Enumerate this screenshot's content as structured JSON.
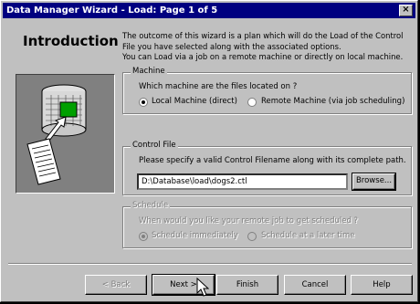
{
  "window": {
    "title": "Data Manager Wizard - Load: Page 1 of 5",
    "close_glyph": "×"
  },
  "page": {
    "heading": "Introduction",
    "intro_line1": "The outcome of this wizard is a plan which will do the Load of the Control",
    "intro_line2": "File you have selected along with the associated options.",
    "intro_line3": "You can Load via a job on a remote machine or directly on local machine."
  },
  "machine": {
    "group_label": "Machine",
    "question": "Which machine are the files located on ?",
    "options": [
      {
        "label": "Local Machine (direct)",
        "checked": true
      },
      {
        "label": "Remote Machine (via job scheduling)",
        "checked": false
      }
    ]
  },
  "control_file": {
    "group_label": "Control File",
    "prompt": "Please specify a valid Control Filename along with its complete path.",
    "value": "D:\\Database\\load\\dogs2.ctl",
    "browse_label": "Browse..."
  },
  "schedule": {
    "group_label": "Schedule",
    "question": "When would you like your remote job to get scheduled ?",
    "options": [
      {
        "label": "Schedule immediately",
        "checked": true
      },
      {
        "label": "Schedule at a later time",
        "checked": false
      }
    ]
  },
  "buttons": {
    "back": "< Back",
    "next": "Next >",
    "finish": "Finish",
    "cancel": "Cancel",
    "help": "Help"
  }
}
